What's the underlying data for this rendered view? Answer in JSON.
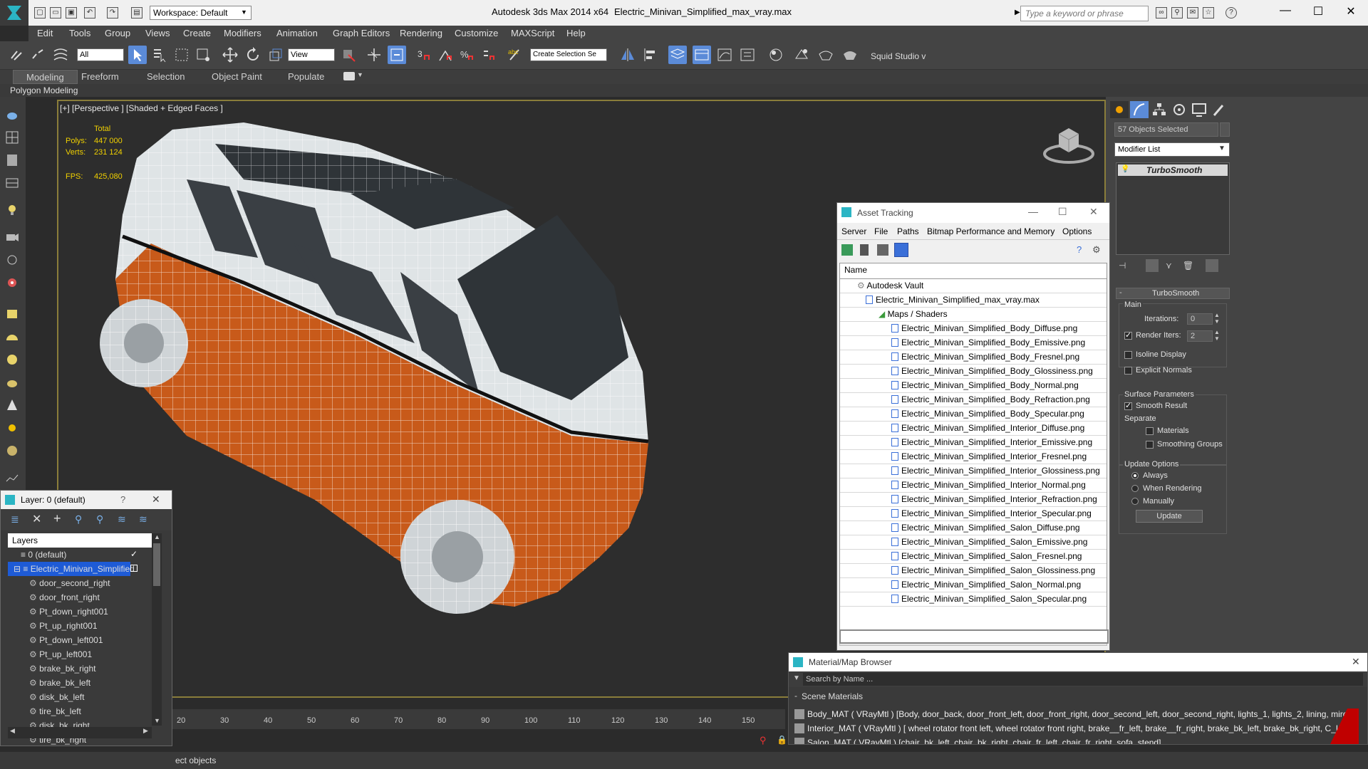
{
  "titlebar": {
    "workspace": "Workspace: Default",
    "app_title": "Autodesk 3ds Max  2014 x64",
    "file_title": "Electric_Minivan_Simplified_max_vray.max",
    "search_placeholder": "Type a keyword or phrase"
  },
  "menu": [
    "Edit",
    "Tools",
    "Group",
    "Views",
    "Create",
    "Modifiers",
    "Animation",
    "Graph Editors",
    "Rendering",
    "Customize",
    "MAXScript",
    "Help"
  ],
  "toolbar": {
    "filter": "All",
    "coord": "View",
    "selection_set": "Create Selection Se",
    "workspace_right": "Squid Studio v"
  },
  "ribbon": {
    "tabs": [
      "Modeling",
      "Freeform",
      "Selection",
      "Object Paint",
      "Populate"
    ],
    "panel_label": "Polygon Modeling"
  },
  "viewport": {
    "label": "[+] [Perspective ] [Shaded + Edged Faces ]",
    "stats": {
      "total_label": "Total",
      "polys_label": "Polys:",
      "polys": "447 000",
      "verts_label": "Verts:",
      "verts": "231 124",
      "fps_label": "FPS:",
      "fps": "425,080"
    }
  },
  "command_panel": {
    "objects_selected": "57 Objects Selected",
    "modifier_list": "Modifier List",
    "stack_item": "TurboSmooth",
    "rollout_title": "TurboSmooth",
    "main_label": "Main",
    "iterations_label": "Iterations:",
    "iterations_value": "0",
    "render_iters_label": "Render Iters:",
    "render_iters_value": "2",
    "isoline": "Isoline Display",
    "explicit_normals": "Explicit Normals",
    "surface_params": "Surface Parameters",
    "smooth_result": "Smooth Result",
    "separate": "Separate",
    "materials": "Materials",
    "smoothing_groups": "Smoothing Groups",
    "update_options": "Update Options",
    "always": "Always",
    "when_rendering": "When Rendering",
    "manually": "Manually",
    "update_button": "Update"
  },
  "asset_tracking": {
    "title": "Asset Tracking",
    "menu": [
      "Server",
      "File",
      "Paths",
      "Bitmap Performance and Memory",
      "Options"
    ],
    "column": "Name",
    "vault": "Autodesk Vault",
    "file": "Electric_Minivan_Simplified_max_vray.max",
    "folder": "Maps / Shaders",
    "maps": [
      "Electric_Minivan_Simplified_Body_Diffuse.png",
      "Electric_Minivan_Simplified_Body_Emissive.png",
      "Electric_Minivan_Simplified_Body_Fresnel.png",
      "Electric_Minivan_Simplified_Body_Glossiness.png",
      "Electric_Minivan_Simplified_Body_Normal.png",
      "Electric_Minivan_Simplified_Body_Refraction.png",
      "Electric_Minivan_Simplified_Body_Specular.png",
      "Electric_Minivan_Simplified_Interior_Diffuse.png",
      "Electric_Minivan_Simplified_Interior_Emissive.png",
      "Electric_Minivan_Simplified_Interior_Fresnel.png",
      "Electric_Minivan_Simplified_Interior_Glossiness.png",
      "Electric_Minivan_Simplified_Interior_Normal.png",
      "Electric_Minivan_Simplified_Interior_Refraction.png",
      "Electric_Minivan_Simplified_Interior_Specular.png",
      "Electric_Minivan_Simplified_Salon_Diffuse.png",
      "Electric_Minivan_Simplified_Salon_Emissive.png",
      "Electric_Minivan_Simplified_Salon_Fresnel.png",
      "Electric_Minivan_Simplified_Salon_Glossiness.png",
      "Electric_Minivan_Simplified_Salon_Normal.png",
      "Electric_Minivan_Simplified_Salon_Specular.png"
    ]
  },
  "layer_window": {
    "title": "Layer: 0 (default)",
    "help": "?",
    "column": "Layers",
    "layers": [
      "0 (default)",
      "Electric_Minivan_Simplified"
    ],
    "objects": [
      "door_second_right",
      "door_front_right",
      "Pt_down_right001",
      "Pt_up_right001",
      "Pt_down_left001",
      "Pt_up_left001",
      "brake_bk_right",
      "brake_bk_left",
      "disk_bk_left",
      "tire_bk_left",
      "disk_bk_right",
      "tire_bk_right"
    ]
  },
  "material_browser": {
    "title": "Material/Map Browser",
    "search_placeholder": "Search by Name ...",
    "group": "Scene Materials",
    "materials": [
      "Body_MAT ( VRayMtl ) [Body, door_back, door_front_left, door_front_right, door_second_left, door_second_right, lights_1, lights_2, lining, mirors, ro...",
      "Interior_MAT ( VRayMtl ) [ wheel rotator front left,  wheel rotator front right, brake__fr_left, brake__fr_right, brake_bk_left, brake_bk_right, C_L/Bac...",
      "Salon_MAT ( VRayMtl ) [chair_bk_left, chair_bk_right, chair_fr_left, chair_fr_right, sofa, stend]"
    ]
  },
  "timeline": {
    "ticks": [
      "20",
      "30",
      "40",
      "50",
      "60",
      "70",
      "80",
      "90",
      "100",
      "110",
      "120",
      "130",
      "140",
      "150"
    ]
  },
  "status": {
    "text": "ect objects"
  },
  "colors": {
    "accent_yellow": "#f0d000",
    "viewport_border": "#8a7d3a",
    "van_orange": "#d0621f",
    "van_white": "#dfe4e6",
    "selection_blue": "#1e5bd6",
    "material_red": "#c00000"
  }
}
